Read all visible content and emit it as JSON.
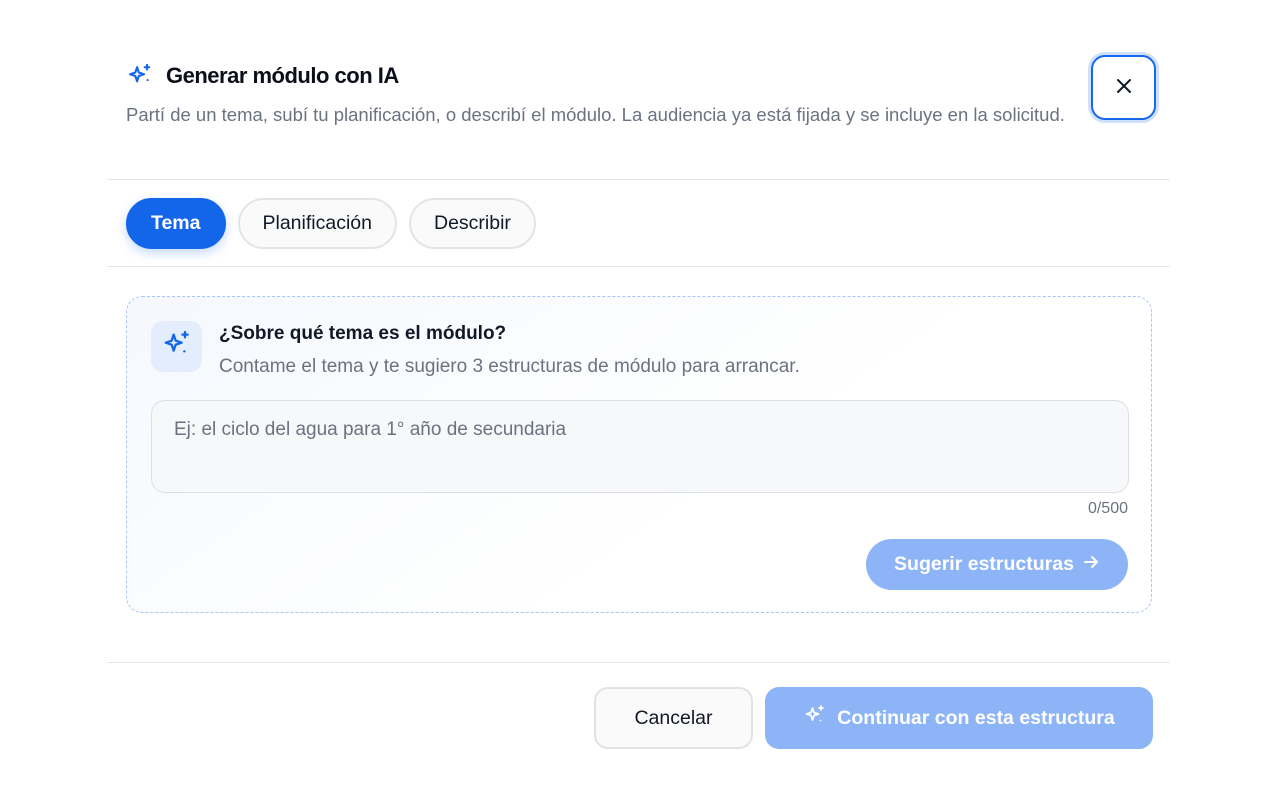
{
  "header": {
    "title": "Generar módulo con IA",
    "subtitle": "Partí de un tema, subí tu planificación, o describí el módulo. La audiencia ya está fijada y se incluye en la solicitud.",
    "close_icon": "close-icon",
    "title_icon": "sparkles-icon"
  },
  "tabs": [
    {
      "label": "Tema",
      "active": true
    },
    {
      "label": "Planificación",
      "active": false
    },
    {
      "label": "Describir",
      "active": false
    }
  ],
  "topic_card": {
    "icon": "sparkles-icon",
    "title": "¿Sobre qué tema es el módulo?",
    "subtitle": "Contame el tema y te sugiero 3 estructuras de módulo para arrancar.",
    "input_value": "",
    "input_placeholder": "Ej: el ciclo del agua para 1° año de secundaria",
    "counter": "0/500",
    "suggest_label": "Sugerir estructuras"
  },
  "footer": {
    "cancel_label": "Cancelar",
    "continue_label": "Continuar con esta estructura"
  },
  "colors": {
    "accent": "#1366ea",
    "accent_disabled": "#8db4f6",
    "muted_text": "#6b7280"
  }
}
